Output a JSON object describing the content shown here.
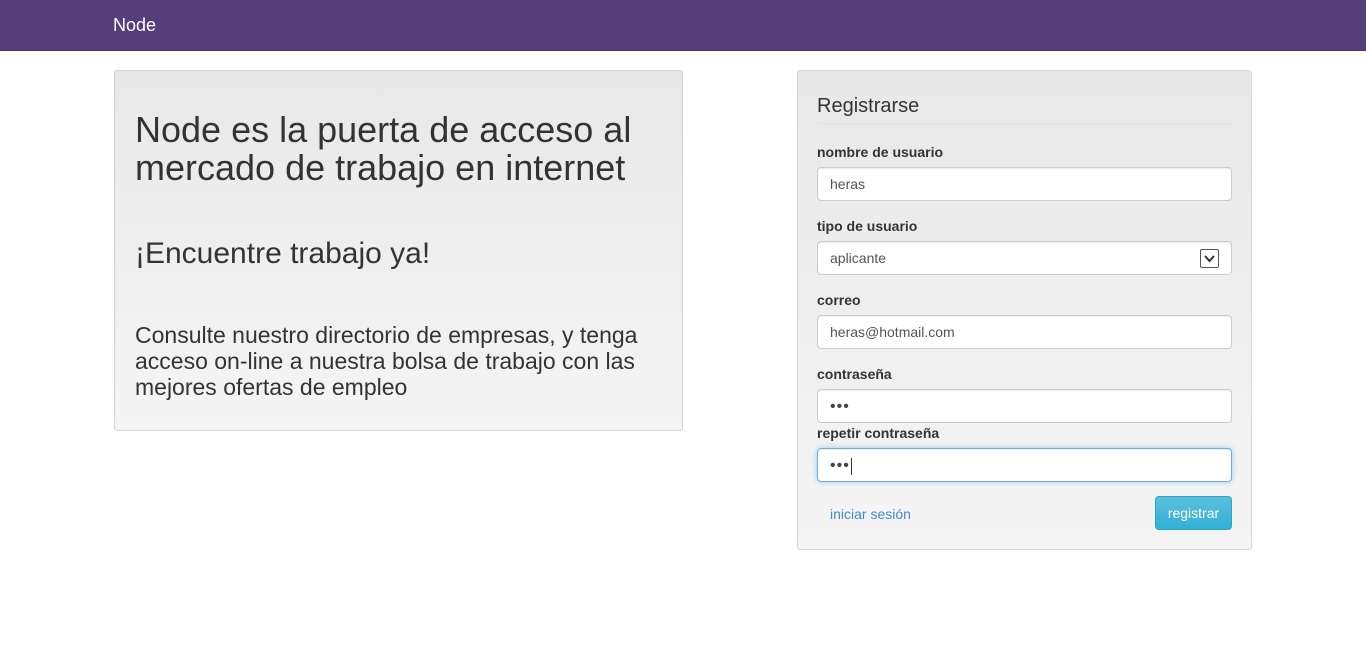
{
  "navbar": {
    "brand": "Node",
    "color": "#563d7c"
  },
  "hero": {
    "title": "Node es la puerta de acceso al mercado de trabajo en internet",
    "subtitle": "¡Encuentre trabajo ya!",
    "description": "Consulte nuestro directorio de empresas, y tenga acceso on-line a nuestra bolsa de trabajo con las mejores ofertas de empleo"
  },
  "register": {
    "title": "Registrarse",
    "username": {
      "label": "nombre de usuario",
      "value": "heras"
    },
    "user_type": {
      "label": "tipo de usuario",
      "value": "aplicante",
      "icon": "chevron-down-icon"
    },
    "email": {
      "label": "correo",
      "value": "heras@hotmail.com"
    },
    "password": {
      "label": "contraseña",
      "value": "•••"
    },
    "repeat_password": {
      "label": "repetir contraseña",
      "value": "•••"
    },
    "login_link": "iniciar sesión",
    "submit_label": "registrar",
    "accent": "#5bc0de",
    "link_color": "#428bca"
  }
}
